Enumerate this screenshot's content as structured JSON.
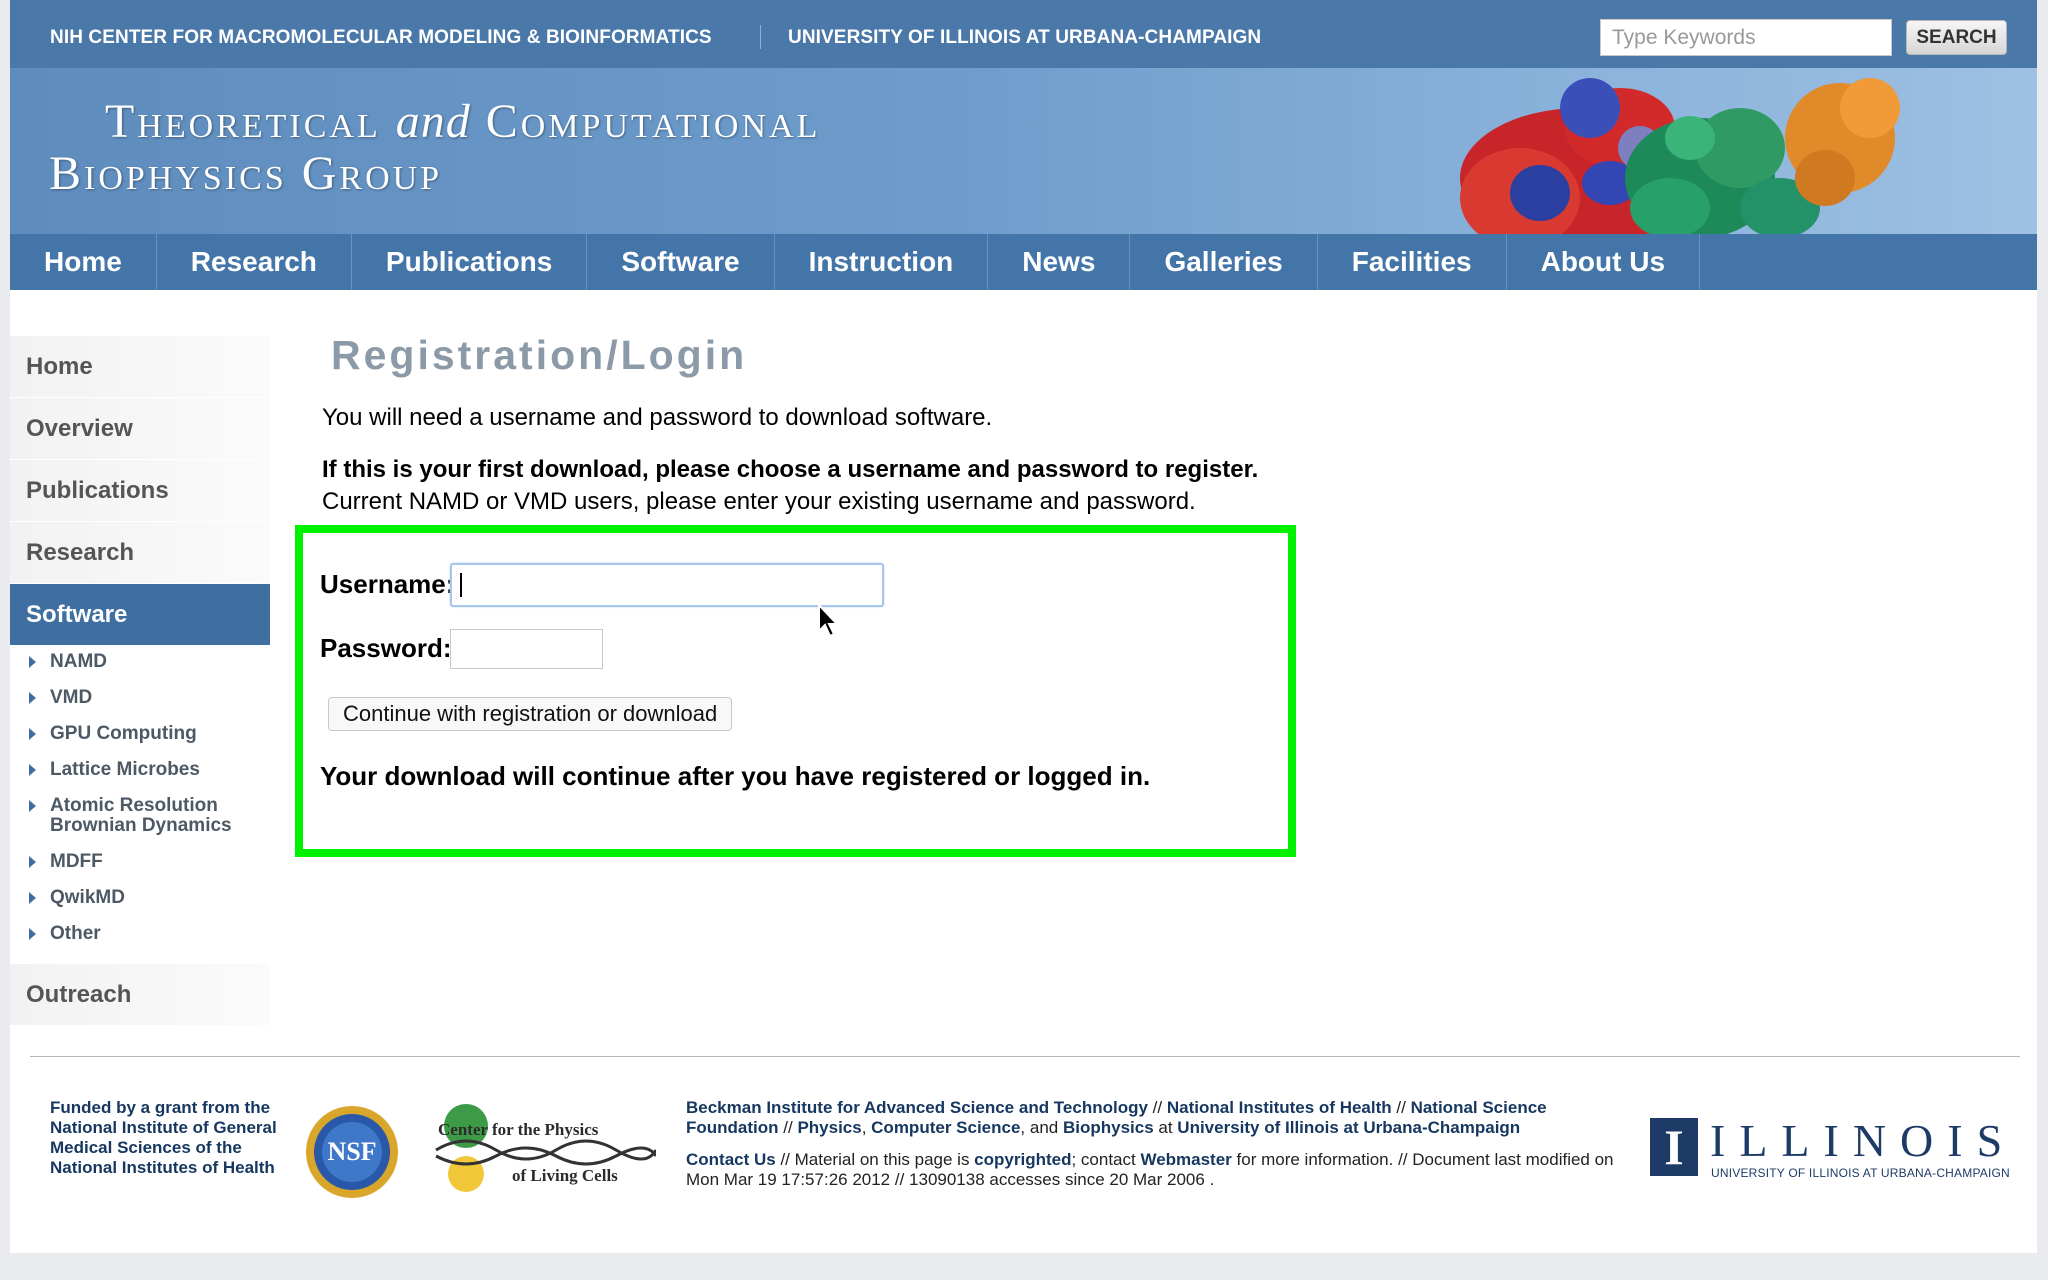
{
  "topbar": {
    "left_org": "NIH CENTER FOR MACROMOLECULAR MODELING & BIOINFORMATICS",
    "right_org": "UNIVERSITY OF ILLINOIS AT URBANA-CHAMPAIGN",
    "search_placeholder": "Type Keywords",
    "search_button": "SEARCH"
  },
  "banner": {
    "line1_a": "Theoretical",
    "line1_b": "and",
    "line1_c": "Computational",
    "line2": "Biophysics Group"
  },
  "nav": [
    "Home",
    "Research",
    "Publications",
    "Software",
    "Instruction",
    "News",
    "Galleries",
    "Facilities",
    "About Us"
  ],
  "sidebar": {
    "items": [
      "Home",
      "Overview",
      "Publications",
      "Research"
    ],
    "active": "Software",
    "sub_items": [
      "NAMD",
      "VMD",
      "GPU Computing",
      "Lattice Microbes",
      "Atomic Resolution Brownian Dynamics",
      "MDFF",
      "QwikMD",
      "Other"
    ],
    "last": "Outreach"
  },
  "main": {
    "title": "Registration/Login",
    "intro": "You will need a username and password to download software.",
    "first_download": "If this is your first download, please choose a username and password to register.",
    "existing_users": "Current NAMD or VMD users, please enter your existing username and password.",
    "username_label": "Username:",
    "username_value": "",
    "password_label": "Password:",
    "continue_button": "Continue with registration or download",
    "note": "Your download will continue after you have registered or logged in."
  },
  "footer": {
    "funded": "Funded by a grant from the National Institute of General Medical Sciences of the National Institutes of Health",
    "nsf": "NSF",
    "cpc_line1": "Center for the Physics",
    "cpc_line2": "of Living Cells",
    "beckman": "Beckman Institute for Advanced Science and Technology",
    "nih": "National Institutes of Health",
    "nsf_full": "National Science Foundation",
    "physics": "Physics",
    "cs": "Computer Science",
    "biophysics": "Biophysics",
    "uiuc": "University of Illinois at Urbana-Champaign",
    "sep": " // ",
    "comma": ", ",
    "and": ", and ",
    "at": " at ",
    "contact": "Contact Us",
    "material": " // Material on this page is ",
    "copyrighted": "copyrighted",
    "contact_text": "; contact ",
    "webmaster": "Webmaster",
    "more_info": " for more information. // Document last modified on Mon Mar 19 17:57:26 2012 // 13090138 accesses since 20 Mar 2006 .",
    "illinois_word": "ILLINOIS",
    "illinois_sub": "UNIVERSITY OF ILLINOIS AT URBANA-CHAMPAIGN"
  },
  "colors": {
    "nav_blue": "#4475a9",
    "topbar_blue": "#4a78a8",
    "highlight_green": "#00f200",
    "title_gray": "#8c9aa8",
    "link_navy": "#16375f"
  }
}
